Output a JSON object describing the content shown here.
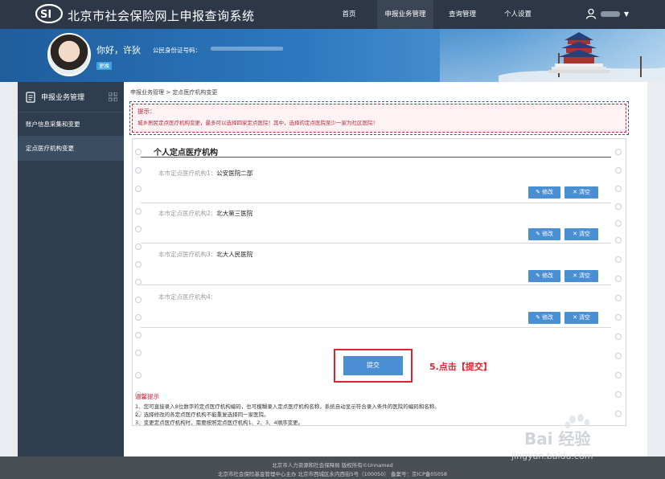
{
  "app": {
    "title": "北京市社会保险网上申报查询系统"
  },
  "nav": {
    "items": [
      "首页",
      "申报业务管理",
      "查询管理",
      "个人设置"
    ],
    "active_index": 1
  },
  "user": {
    "name": "",
    "caret": "▼"
  },
  "banner": {
    "greeting": "你好，许狄",
    "id_label": "公民身份证号码：",
    "badge": "更换"
  },
  "sidebar": {
    "title": "申报业务管理",
    "items": [
      "账户信息采集和变更",
      "定点医疗机构变更"
    ],
    "active_index": 1
  },
  "main": {
    "breadcrumb": "申报业务管理 > 定点医疗机构变更",
    "hint": {
      "title": "提示：",
      "text": "城乡居民定点医疗机构变更，最多可以选择四家定点医院！其中，选择的定点医院至少一家为社区医院！"
    },
    "panel_title": "个人定点医疗机构",
    "rows": [
      {
        "label": "本市定点医疗机构1：",
        "value": "公安医院二部"
      },
      {
        "label": "本市定点医疗机构2：",
        "value": "北大第三医院"
      },
      {
        "label": "本市定点医疗机构3：",
        "value": "北大人民医院"
      },
      {
        "label": "本市定点医疗机构4：",
        "value": ""
      }
    ],
    "edit_label": "修改",
    "clear_label": "清空",
    "submit_label": "提交",
    "annotation": "5.点击【提交】",
    "tips_title": "温馨提示",
    "tips": [
      "1、您可直接录入8位数字的定点医疗机构编码，也可模糊录入定点医疗机构名称，系统自动显示符合录入条件的医院的编码和名称。",
      "2、选择修改的各定点医疗机构不能重复选择同一家医院。",
      "3、变更定点医疗机构时，需要按照定点医疗机构1、2、3、4顺序变更。"
    ]
  },
  "footer": {
    "line1": "北京市人力资源和社会保障局 版权所有©Unnamed",
    "line2": "北京市社会保险基金管理中心主办    北京市西城区永内西街5号（100050）    备案号：京ICP备05058"
  },
  "watermark": {
    "text": "Bai 经验",
    "url": "jingyan.baidu.com"
  },
  "colors": {
    "topbar": "#2d3748",
    "sidebar": "#2f3e4f",
    "accent_blue": "#4a8fd4",
    "hint_red": "#c0283a",
    "annotation_red": "#d8262f"
  }
}
